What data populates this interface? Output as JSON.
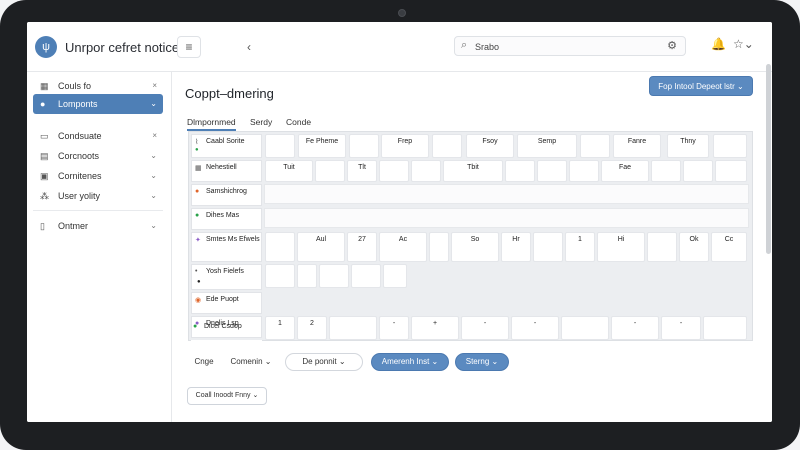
{
  "app": {
    "title": "Unrpor cefret notice",
    "logo_icon": "logo-icon"
  },
  "topbar": {
    "menu_icon": "menu-icon",
    "back_label": "‹",
    "search_placeholder": "Search",
    "search_value": "Srabo",
    "icons": [
      "settings-icon",
      "bell-icon",
      "star-icon"
    ]
  },
  "sidebar": {
    "items": [
      {
        "label": "Couls fo",
        "icon": "grid-icon",
        "chev": "×"
      },
      {
        "label": "Lomponts",
        "icon": "user-icon",
        "chev": "⌄",
        "active": true
      },
      {
        "label": "Condsuate",
        "icon": "chat-icon",
        "chev": "×"
      },
      {
        "label": "Corcnoots",
        "icon": "table-icon",
        "chev": "⌄"
      },
      {
        "label": "Cornitenes",
        "icon": "box-icon",
        "chev": "⌄"
      },
      {
        "label": "User yolity",
        "icon": "users-icon",
        "chev": "⌄"
      },
      {
        "label": "Ontmer",
        "icon": "document-icon",
        "chev": "⌄"
      }
    ]
  },
  "main": {
    "title": "Coppt–dmering",
    "primary_button": "Fop Intool Depeot lstr ⌄",
    "tabs": [
      "Dlmpornmed",
      "Serdy",
      "Conde"
    ],
    "grid": {
      "header_cells": [
        {
          "col": 0,
          "text": "Fe Pheme"
        },
        {
          "col": 1,
          "text": "Frep"
        },
        {
          "col": 2,
          "text": "Fsoy"
        },
        {
          "col": 3,
          "text": "Semp"
        },
        {
          "col": 4,
          "text": "Fanre"
        },
        {
          "col": 5,
          "text": "Thny"
        }
      ],
      "sub_header": [
        "Tuit",
        "Tlt",
        "Tbit",
        "Fae"
      ],
      "rows": [
        {
          "label": "Caabl Sorite",
          "sub": "●"
        },
        {
          "label": "Nehestiell",
          "sub": ""
        },
        {
          "label": "Samshichrog",
          "sub": ""
        },
        {
          "label": "Dihes Mas",
          "sub": ""
        },
        {
          "label": "Smtes Ms Efwels",
          "sub": ""
        },
        {
          "label": "Yosh Fielefs",
          "sub": "●"
        },
        {
          "label": "Ede Puopt",
          "sub": ""
        },
        {
          "label": "Dnelis Lsp",
          "sub": ""
        },
        {
          "label": "Dicel Csdop",
          "sub": ""
        }
      ],
      "row5_values": [
        "Aul",
        "27",
        "Ac",
        "So",
        "Hr",
        "1",
        "Hi",
        "Ok",
        "Cc"
      ],
      "row8_values": [
        "1",
        "2",
        "-",
        "+",
        "-",
        "-",
        "-",
        "-"
      ]
    },
    "chips": [
      "Cnge",
      "Comenin ⌄",
      "De ponnit ⌄",
      "Amerenh Inst ⌄",
      "Sterng ⌄"
    ],
    "filter_button": "Coall Inoodt Fnny ⌄"
  }
}
